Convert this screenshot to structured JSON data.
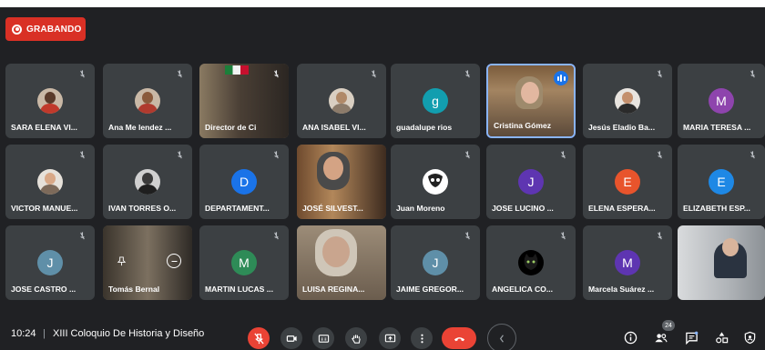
{
  "recording": {
    "label": "GRABANDO"
  },
  "participants": [
    {
      "name": "SARA ELENA VI...",
      "type": "photo"
    },
    {
      "name": "Ana Me lendez ...",
      "type": "photo"
    },
    {
      "name": "Director de Ci",
      "type": "video"
    },
    {
      "name": "ANA ISABEL VI...",
      "type": "photo"
    },
    {
      "name": "guadalupe rios",
      "type": "initial",
      "initial": "g",
      "color": "#129eaf"
    },
    {
      "name": "Cristina Gómez",
      "type": "video",
      "speaking": true
    },
    {
      "name": "Jesús Eladio Ba...",
      "type": "photo"
    },
    {
      "name": "MARIA TERESA ...",
      "type": "initial",
      "initial": "M",
      "color": "#8e44ad"
    },
    {
      "name": "VICTOR MANUE...",
      "type": "photo"
    },
    {
      "name": "IVAN TORRES O...",
      "type": "photo"
    },
    {
      "name": "DEPARTAMENT...",
      "type": "initial",
      "initial": "D",
      "color": "#1a73e8"
    },
    {
      "name": "JOSÉ SILVEST...",
      "type": "video"
    },
    {
      "name": "Juan Moreno",
      "type": "photo"
    },
    {
      "name": "JOSE LUCINO ...",
      "type": "initial",
      "initial": "J",
      "color": "#5e35b1"
    },
    {
      "name": "ELENA ESPERA...",
      "type": "initial",
      "initial": "E",
      "color": "#e8542c"
    },
    {
      "name": "ELIZABETH ESP...",
      "type": "initial",
      "initial": "E",
      "color": "#1e88e5"
    },
    {
      "name": "JOSE CASTRO ...",
      "type": "initial",
      "initial": "J",
      "color": "#5f8fa8"
    },
    {
      "name": "Tomás Bernal",
      "type": "video"
    },
    {
      "name": "MARTIN LUCAS ...",
      "type": "initial",
      "initial": "M",
      "color": "#2e8b57"
    },
    {
      "name": "LUISA REGINA...",
      "type": "video"
    },
    {
      "name": "JAIME GREGOR...",
      "type": "initial",
      "initial": "J",
      "color": "#5f8fa8"
    },
    {
      "name": "ANGELICA CO...",
      "type": "photo"
    },
    {
      "name": "Marcela Suárez ...",
      "type": "initial",
      "initial": "M",
      "color": "#5e35b1"
    },
    {
      "name": "",
      "type": "video"
    }
  ],
  "bottom_bar": {
    "time": "10:24",
    "separator": "|",
    "meeting_title": "XIII Coloquio De Historia y Diseño",
    "participant_count": "24"
  },
  "icons": {
    "mic": "mic-off-icon",
    "camera": "camera-icon",
    "captions": "captions-icon",
    "hand": "raise-hand-icon",
    "present": "present-screen-icon",
    "more": "more-options-icon",
    "end": "end-call-icon",
    "info": "info-icon",
    "people": "people-icon",
    "chat": "chat-icon",
    "activities": "activities-icon",
    "host": "host-controls-icon"
  }
}
